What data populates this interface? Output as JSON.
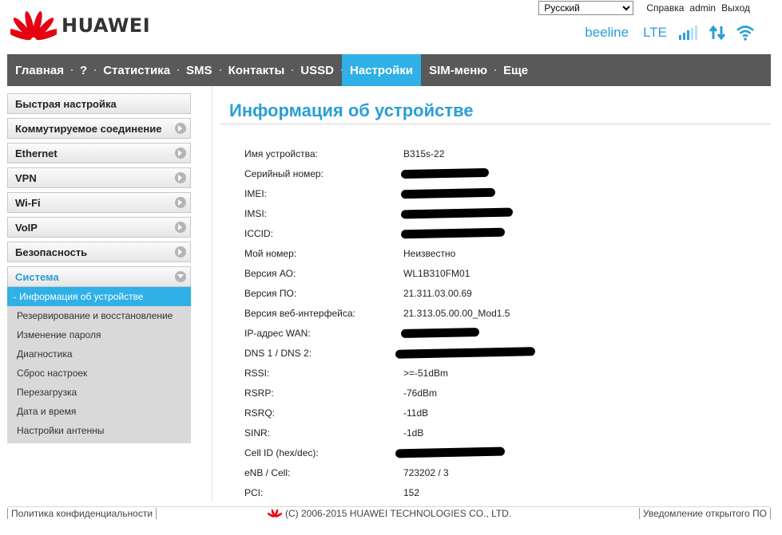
{
  "header": {
    "brand": "HUAWEI",
    "language": {
      "selected": "Русский",
      "options": [
        "Русский"
      ]
    },
    "links": {
      "help": "Справка",
      "user": "admin",
      "logout": "Выход"
    },
    "status": {
      "operator": "beeline",
      "network_type": "LTE"
    }
  },
  "nav": {
    "items": [
      "Главная",
      "?",
      "Статистика",
      "SMS",
      "Контакты",
      "USSD",
      "Настройки",
      "SIM-меню",
      "Еще"
    ],
    "active": "Настройки"
  },
  "sidebar": {
    "sections": [
      "Быстрая настройка",
      "Коммутируемое соединение",
      "Ethernet",
      "VPN",
      "Wi-Fi",
      "VoIP",
      "Безопасность",
      "Система"
    ],
    "open_section": "Система",
    "submenu": [
      "Информация об устройстве",
      "Резервирование и восстановление",
      "Изменение пароля",
      "Диагностика",
      "Сброс настроек",
      "Перезагрузка",
      "Дата и время",
      "Настройки антенны"
    ],
    "active_item": "Информация об устройстве"
  },
  "content": {
    "title": "Информация об устройстве",
    "rows": [
      {
        "label": "Имя устройства:",
        "value": "B315s-22"
      },
      {
        "label": "Серийный номер:",
        "value": "",
        "redacted": true
      },
      {
        "label": "IMEI:",
        "value": "",
        "redacted": true
      },
      {
        "label": "IMSI:",
        "value": "",
        "redacted": true
      },
      {
        "label": "ICCID:",
        "value": "",
        "redacted": true
      },
      {
        "label": "Мой номер:",
        "value": "Неизвестно"
      },
      {
        "label": "Версия АО:",
        "value": "WL1B310FM01"
      },
      {
        "label": "Версия ПО:",
        "value": "21.311.03.00.69"
      },
      {
        "label": "Версия веб-интерфейса:",
        "value": "21.313.05.00.00_Mod1.5"
      },
      {
        "label": "IP-адрес WAN:",
        "value": "",
        "redacted": true
      },
      {
        "label": "DNS 1 / DNS 2:",
        "value": "",
        "redacted": true
      },
      {
        "label": "RSSI:",
        "value": ">=-51dBm"
      },
      {
        "label": "RSRP:",
        "value": "-76dBm"
      },
      {
        "label": "RSRQ:",
        "value": "-11dB"
      },
      {
        "label": "SINR:",
        "value": "-1dB"
      },
      {
        "label": "Cell ID (hex/dec):",
        "value": "",
        "redacted": true
      },
      {
        "label": "eNB / Cell:",
        "value": "723202 / 3"
      },
      {
        "label": "PCI:",
        "value": "152"
      }
    ]
  },
  "footer": {
    "privacy": "Политика конфиденциальности",
    "copyright": "(C) 2006-2015 HUAWEI TECHNOLOGIES CO., LTD.",
    "open_source": "Уведомление открытого ПО"
  },
  "colors": {
    "accent": "#2fb0e6",
    "nav_bg": "#595959",
    "logo_red": "#e60012"
  },
  "icons": [
    "huawei-logo-icon",
    "signal-strength-icon",
    "data-transfer-icon",
    "wifi-icon",
    "chevron-right-icon",
    "chevron-down-icon"
  ]
}
